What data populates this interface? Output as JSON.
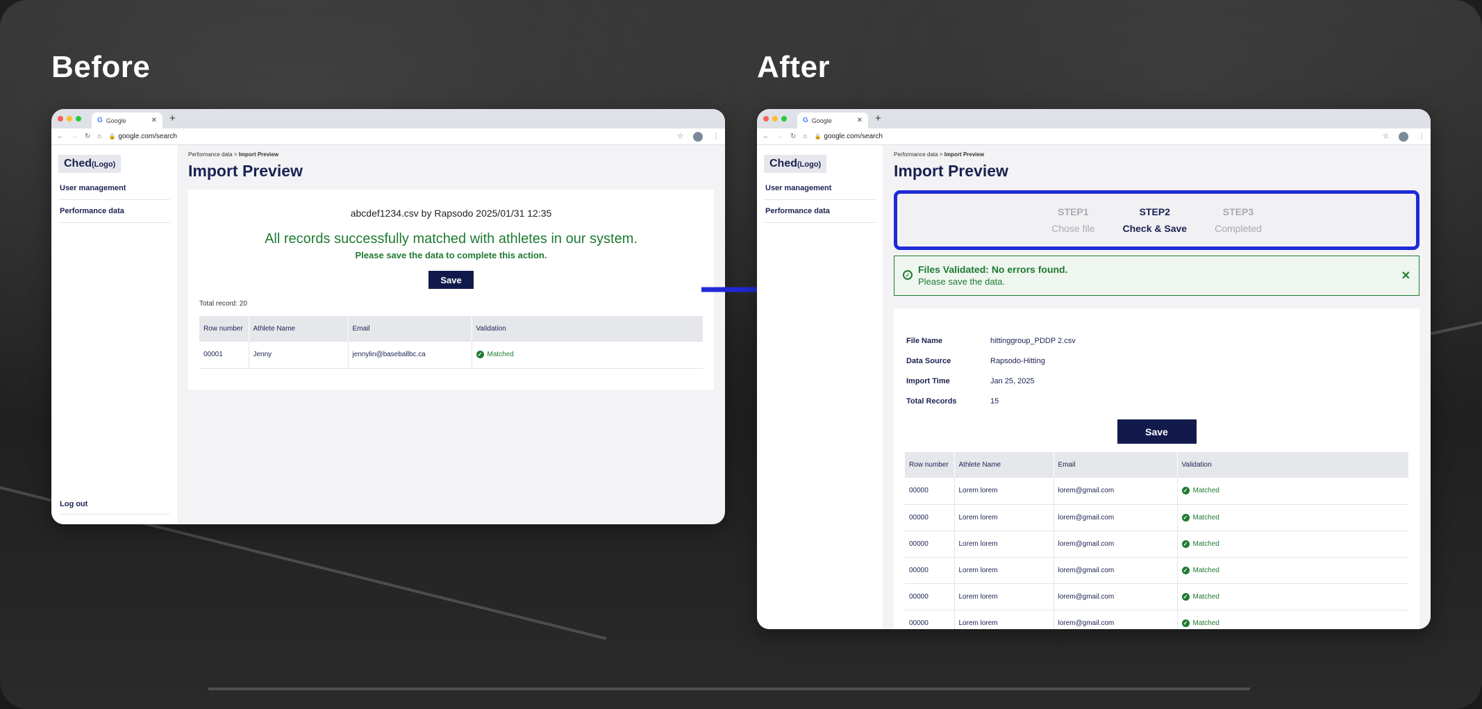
{
  "before": {
    "heading": "Before",
    "browser": {
      "tab_title": "Google",
      "url": "google.com/search"
    },
    "sidebar": {
      "logo": "Ched",
      "logo_suffix": "(Logo)",
      "items": [
        {
          "label": "User management"
        },
        {
          "label": "Performance data"
        }
      ],
      "logout": "Log out"
    },
    "breadcrumb": {
      "parent": "Performance data",
      "sep": " > ",
      "current": "Import Preview"
    },
    "page_title": "Import Preview",
    "file_info": "abcdef1234.csv by Rapsodo 2025/01/31 12:35",
    "success_title": "All records successfully matched with athletes in our system.",
    "success_sub": "Please save the data to complete this action.",
    "save_label": "Save",
    "total_record": "Total record: 20",
    "table": {
      "headers": [
        "Row number",
        "Athlete Name",
        "Email",
        "Validation"
      ],
      "rows": [
        {
          "row": "00001",
          "name": "Jenny",
          "email": "jennylin@baseballbc.ca",
          "validation": "Matched"
        }
      ]
    }
  },
  "after": {
    "heading": "After",
    "browser": {
      "tab_title": "Google",
      "url": "google.com/search"
    },
    "sidebar": {
      "logo": "Ched",
      "logo_suffix": "(Logo)",
      "items": [
        {
          "label": "User management"
        },
        {
          "label": "Performance data"
        }
      ]
    },
    "breadcrumb": {
      "parent": "Performance data",
      "sep": " > ",
      "current": "Import Preview"
    },
    "page_title": "Import Preview",
    "steps": [
      {
        "num": "STEP1",
        "label": "Chose file"
      },
      {
        "num": "STEP2",
        "label": "Check & Save"
      },
      {
        "num": "STEP3",
        "label": "Completed"
      }
    ],
    "alert": {
      "title": "Files Validated: No errors found.",
      "subtitle": "Please save the data.",
      "close": "✕"
    },
    "meta": [
      {
        "key": "File Name",
        "value": "hittinggroup_PDDP 2.csv"
      },
      {
        "key": "Data Source",
        "value": "Rapsodo-Hitting"
      },
      {
        "key": "Import Time",
        "value": "Jan 25, 2025"
      },
      {
        "key": "Total Records",
        "value": "15"
      }
    ],
    "save_label": "Save",
    "table": {
      "headers": [
        "Row number",
        "Athlete Name",
        "Email",
        "Validation"
      ],
      "rows": [
        {
          "row": "00000",
          "name": "Lorem lorem",
          "email": "lorem@gmail.com",
          "validation": "Matched"
        },
        {
          "row": "00000",
          "name": "Lorem lorem",
          "email": "lorem@gmail.com",
          "validation": "Matched"
        },
        {
          "row": "00000",
          "name": "Lorem lorem",
          "email": "lorem@gmail.com",
          "validation": "Matched"
        },
        {
          "row": "00000",
          "name": "Lorem lorem",
          "email": "lorem@gmail.com",
          "validation": "Matched"
        },
        {
          "row": "00000",
          "name": "Lorem lorem",
          "email": "lorem@gmail.com",
          "validation": "Matched"
        },
        {
          "row": "00000",
          "name": "Lorem lorem",
          "email": "lorem@gmail.com",
          "validation": "Matched"
        }
      ]
    }
  },
  "colors": {
    "accent_blue": "#1f2ad6",
    "navy": "#121a4b",
    "success_green": "#1f7a32"
  }
}
